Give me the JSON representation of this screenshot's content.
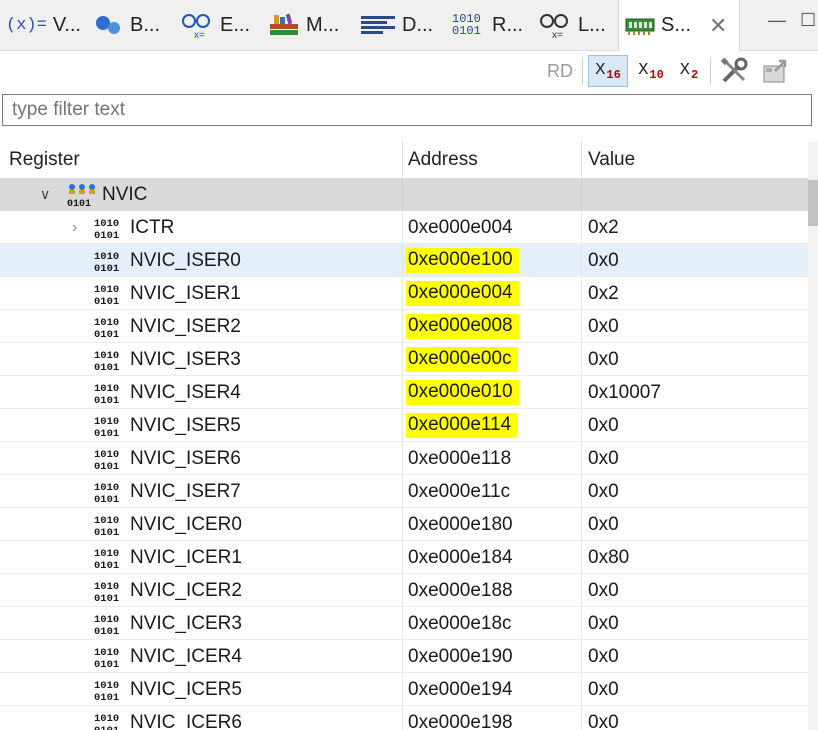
{
  "tabs": [
    {
      "label": "V...",
      "icon": "variables-icon"
    },
    {
      "label": "B...",
      "icon": "breakpoints-icon"
    },
    {
      "label": "E...",
      "icon": "expressions-icon"
    },
    {
      "label": "M...",
      "icon": "modules-icon"
    },
    {
      "label": "D...",
      "icon": "disassembly-icon"
    },
    {
      "label": "R...",
      "icon": "registers-icon"
    },
    {
      "label": "L...",
      "icon": "live-expressions-icon"
    },
    {
      "label": "S...",
      "icon": "sfrs-icon",
      "active": true
    }
  ],
  "window_controls": {
    "minimize": "—",
    "maximize": "☐"
  },
  "toolbar": {
    "rd_label": "RD",
    "hex": {
      "base": "X",
      "sub": "16"
    },
    "dec": {
      "base": "X",
      "sub": "10"
    },
    "bin": {
      "base": "X",
      "sub": "2"
    }
  },
  "filter": {
    "placeholder": "type filter text"
  },
  "columns": {
    "register": "Register",
    "address": "Address",
    "value": "Value"
  },
  "group": {
    "name": "NVIC"
  },
  "rows": [
    {
      "name": "ICTR",
      "address": "0xe000e004",
      "value": "0x2",
      "expandable": true,
      "highlight": false
    },
    {
      "name": "NVIC_ISER0",
      "address": "0xe000e100",
      "value": "0x0",
      "highlight": true,
      "selected": true
    },
    {
      "name": "NVIC_ISER1",
      "address": "0xe000e004",
      "value": "0x2",
      "highlight": true
    },
    {
      "name": "NVIC_ISER2",
      "address": "0xe000e008",
      "value": "0x0",
      "highlight": true
    },
    {
      "name": "NVIC_ISER3",
      "address": "0xe000e00c",
      "value": "0x0",
      "highlight": true
    },
    {
      "name": "NVIC_ISER4",
      "address": "0xe000e010",
      "value": "0x10007",
      "highlight": true
    },
    {
      "name": "NVIC_ISER5",
      "address": "0xe000e114",
      "value": "0x0",
      "highlight": true
    },
    {
      "name": "NVIC_ISER6",
      "address": "0xe000e118",
      "value": "0x0",
      "highlight": false
    },
    {
      "name": "NVIC_ISER7",
      "address": "0xe000e11c",
      "value": "0x0",
      "highlight": false
    },
    {
      "name": "NVIC_ICER0",
      "address": "0xe000e180",
      "value": "0x0",
      "highlight": false
    },
    {
      "name": "NVIC_ICER1",
      "address": "0xe000e184",
      "value": "0x80",
      "highlight": false
    },
    {
      "name": "NVIC_ICER2",
      "address": "0xe000e188",
      "value": "0x0",
      "highlight": false
    },
    {
      "name": "NVIC_ICER3",
      "address": "0xe000e18c",
      "value": "0x0",
      "highlight": false
    },
    {
      "name": "NVIC_ICER4",
      "address": "0xe000e190",
      "value": "0x0",
      "highlight": false
    },
    {
      "name": "NVIC_ICER5",
      "address": "0xe000e194",
      "value": "0x0",
      "highlight": false
    },
    {
      "name": "NVIC_ICER6",
      "address": "0xe000e198",
      "value": "0x0",
      "highlight": false
    }
  ],
  "colors": {
    "highlight": "#ffff00",
    "selected_row": "#e4effa",
    "group_row": "#d9d9d9",
    "accent_red": "#c00000"
  }
}
